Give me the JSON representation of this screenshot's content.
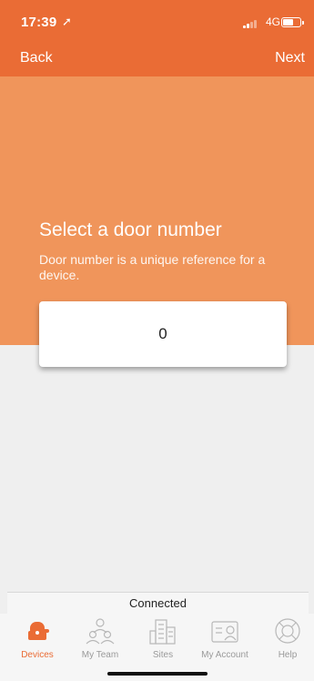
{
  "status_bar": {
    "time": "17:39",
    "location_symbol": "➚",
    "network": "4G"
  },
  "nav": {
    "back_label": "Back",
    "next_label": "Next"
  },
  "content": {
    "title": "Select a door number",
    "subtitle": "Door number is a unique reference for a device.",
    "door_number_value": "0"
  },
  "connection": {
    "status": "Connected"
  },
  "tabs": [
    {
      "label": "Devices",
      "icon": "devices-icon",
      "active": true
    },
    {
      "label": "My Team",
      "icon": "team-icon",
      "active": false
    },
    {
      "label": "Sites",
      "icon": "sites-icon",
      "active": false
    },
    {
      "label": "My Account",
      "icon": "account-icon",
      "active": false
    },
    {
      "label": "Help",
      "icon": "help-icon",
      "active": false
    }
  ],
  "colors": {
    "accent": "#ea6c35",
    "hero": "#f0955b",
    "background": "#efefef"
  }
}
